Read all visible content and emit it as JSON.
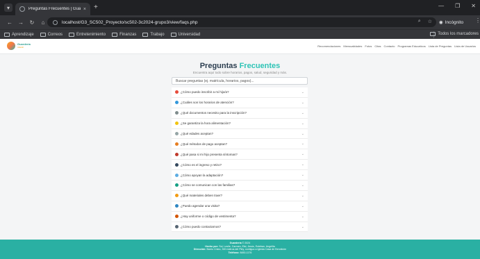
{
  "browser": {
    "tab_title": "Preguntas Frecuentes | Guardería",
    "tab_close": "×",
    "new_tab": "+",
    "url": "localhost/G3_SC502_Proyecto/sc502-3c2024-grupo3/view/faqs.php",
    "incognito_label": "Incógnito",
    "bookmarks": [
      "Aprendizaje",
      "Correos",
      "Entretenimiento",
      "Finanzas",
      "Trabajo",
      "Universidad"
    ],
    "all_bookmarks": "Todos los marcadores"
  },
  "site": {
    "logo_line1": "Guardería",
    "logo_line2": "Infantil",
    "nav": [
      "Recomendaciones",
      "Mensualidades",
      "Fotos",
      "Citas",
      "Contacto",
      "Programas Educativos",
      "Lista de Preguntas",
      "Lista de Usuarios"
    ]
  },
  "faq": {
    "title_main": "Preguntas",
    "title_accent": "Frecuentes",
    "subtitle": "Encuentra aquí todo sobre horarios, pagos, salud, seguridad y más.",
    "search_placeholder": "Buscar preguntas (ej. matrícula, horarios, pagos)...",
    "items": [
      {
        "q": "¿Cómo puedo inscribir a mi hijo/a?",
        "color": "#e74c3c"
      },
      {
        "q": "¿Cuáles son los horarios de atención?",
        "color": "#3498db"
      },
      {
        "q": "¿Qué documentos necesito para la inscripción?",
        "color": "#7f8c8d"
      },
      {
        "q": "¿Se garantiza la hora alimentación?",
        "color": "#f1c40f"
      },
      {
        "q": "¿Qué edades aceptan?",
        "color": "#95a5a6"
      },
      {
        "q": "¿Qué métodos de pago aceptan?",
        "color": "#e67e22"
      },
      {
        "q": "¿Qué pasa si mi hijo presenta síntomas?",
        "color": "#c0392b"
      },
      {
        "q": "¿Cómo es el ingreso y retiro?",
        "color": "#34495e"
      },
      {
        "q": "¿Cómo apoyan la adaptación?",
        "color": "#5dade2"
      },
      {
        "q": "¿Cómo se comunican con las familias?",
        "color": "#16a085"
      },
      {
        "q": "¿Qué materiales deben traer?",
        "color": "#f39c12"
      },
      {
        "q": "¿Puedo agendar una visita?",
        "color": "#2e86c1"
      },
      {
        "q": "¿Hay uniforme o código de vestimenta?",
        "color": "#d35400"
      },
      {
        "q": "¿Cómo puedo contactarnos?",
        "color": "#566573"
      }
    ]
  },
  "footer": {
    "line1_label": "Guardería",
    "line1_value": "© 2024",
    "line2_label": "Hecho por:",
    "line2_value": "Sol, Leslie, Carmen, Elsi, Jesús, Esteban, Angelita",
    "line3_label": "Dirección:",
    "line3_value": "Barrio Cristo, 300 metros del Pley, contiguo a Iglesia Casa de Bendición",
    "line4_label": "Teléfono:",
    "line4_value": "8450-1176"
  }
}
